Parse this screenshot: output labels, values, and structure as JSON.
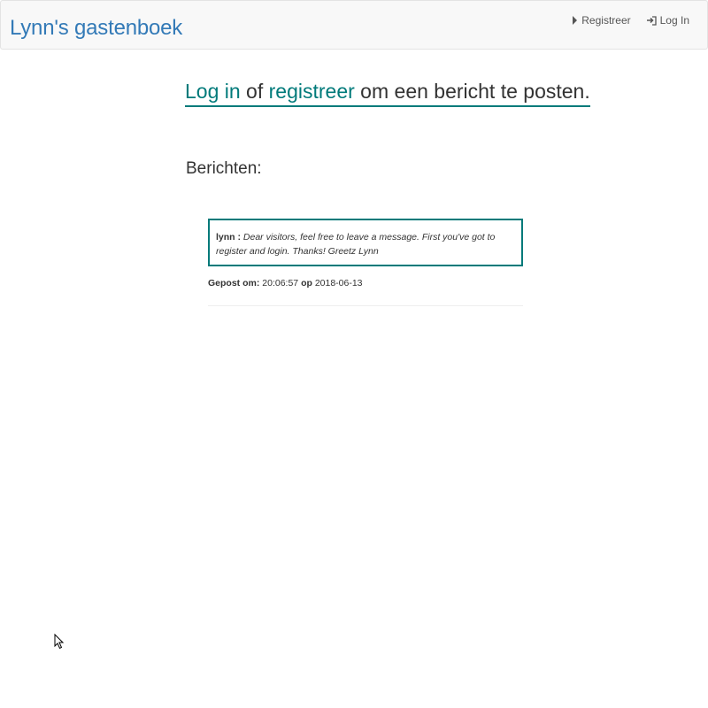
{
  "navbar": {
    "brand": "Lynn's gastenboek",
    "links": [
      {
        "label": "Registreer",
        "icon": "triangle-right-icon"
      },
      {
        "label": "Log In",
        "icon": "log-in-icon"
      }
    ]
  },
  "cta": {
    "login_link": "Log in",
    "or_text": " of ",
    "register_link": "registreer",
    "rest_text": " om een bericht te posten."
  },
  "messages_section": {
    "title": "Berichten:",
    "messages": [
      {
        "author": "lynn :",
        "text": "Dear visitors, feel free to leave a message. First you've got to register and login. Thanks! Greetz Lynn",
        "posted_label": "Gepost om:",
        "time": "20:06:57",
        "on_label": "op",
        "date": "2018-06-13"
      }
    ]
  },
  "colors": {
    "brand": "#337ab7",
    "accent": "#007a7a",
    "navbar_bg": "#f8f8f8"
  }
}
